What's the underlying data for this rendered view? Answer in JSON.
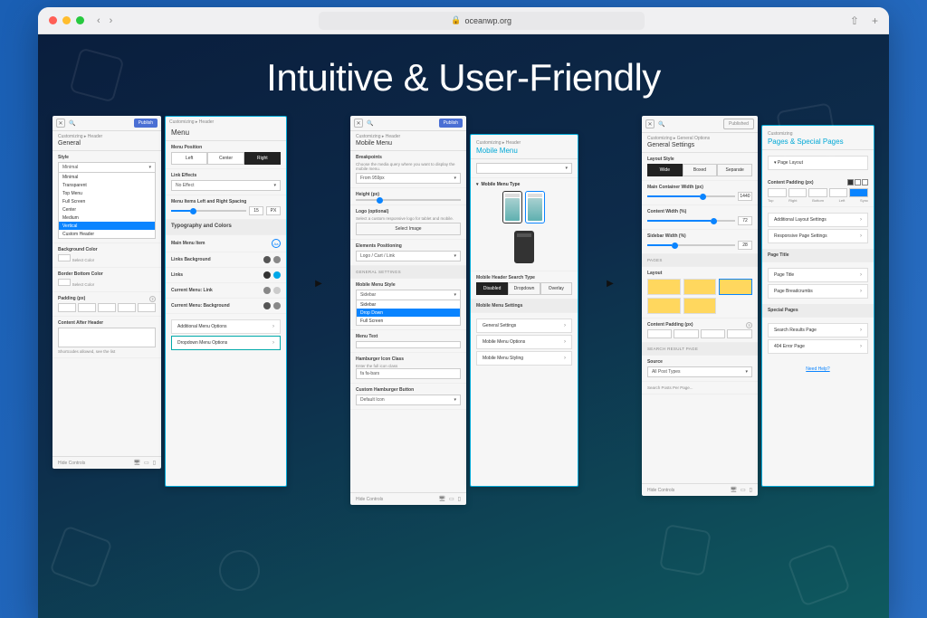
{
  "browser": {
    "url": "oceanwp.org"
  },
  "headline": "Intuitive & User-Friendly",
  "publish": "Publish",
  "published": "Published",
  "panel1a": {
    "breadcrumb": "Customizing ▸ Header",
    "title": "General",
    "style_label": "Style",
    "style_selected": "Minimal",
    "style_opts": [
      "Minimal",
      "Transparent",
      "Top Menu",
      "Full Screen",
      "Center",
      "Medium"
    ],
    "style_highlight": "Vertical",
    "style_last": "Custom Header",
    "bg_label": "Background Color",
    "select_color": "Select Color",
    "border_label": "Border Bottom Color",
    "padding_label": "Padding (px)",
    "content_after": "Content After Header",
    "shortcodes": "Shortcodes allowed, see the list",
    "hide_controls": "Hide Controls"
  },
  "panel1b": {
    "breadcrumb": "Customizing ▸ Header",
    "title": "Menu",
    "menu_position": "Menu Position",
    "pos_left": "Left",
    "pos_center": "Center",
    "pos_right": "Right",
    "link_effects": "Link Effects",
    "no_effect": "No Effect",
    "spacing": "Menu Items Left and Right Spacing",
    "spacing_val": "15",
    "spacing_px": "PX",
    "typography": "Typography and Colors",
    "main_menu_item": "Main Menu Item",
    "links_bg": "Links Background",
    "links": "Links",
    "current_link": "Current Menu: Link",
    "current_bg": "Current Menu: Background",
    "additional": "Additional Menu Options",
    "dropdown": "Dropdown Menu Options"
  },
  "panel2a": {
    "breadcrumb": "Customizing ▸ Header",
    "title": "Mobile Menu",
    "breakpoints": "Breakpoints",
    "breakpoints_desc": "Choose the media query where you want to display the mobile menu.",
    "from": "From 959px",
    "height": "Height (px)",
    "logo": "Logo (optional)",
    "logo_desc": "Select a custom responsive logo for tablet and mobile.",
    "select_image": "Select Image",
    "elements_pos": "Elements Positioning",
    "logo_cart": "Logo / Cart / Link",
    "general_settings": "GENERAL SETTINGS",
    "mobile_style": "Mobile Menu Style",
    "style_sel": "Sidebar",
    "style_opts": [
      "Sidebar",
      "Drop Down",
      "Full Screen"
    ],
    "style_highlight": "Drop Down",
    "menu_text": "Menu Text",
    "hamburger": "Hamburger Icon Class",
    "hamburger_desc": "Enter the full icon class",
    "fa_bars": "fa fa-bars",
    "custom_btn": "Custom Hamburger Button",
    "default": "Default Icon",
    "hide_controls": "Hide Controls"
  },
  "panel2b": {
    "breadcrumb": "Customizing ▸ Header",
    "title": "Mobile Menu",
    "type_label": "Mobile Menu Type",
    "search_label": "Mobile Header Search Type",
    "disabled": "Disabled",
    "dropdown": "Dropdown",
    "overlay": "Overlay",
    "settings": "Mobile Menu Settings",
    "general": "General Settings",
    "options": "Mobile Menu Options",
    "styling": "Mobile Menu Styling"
  },
  "panel3a": {
    "breadcrumb": "Customizing ▸ General Options",
    "title": "General Settings",
    "layout_style": "Layout Style",
    "wide": "Wide",
    "boxed": "Boxed",
    "separate": "Separate",
    "container_width": "Main Container Width (px)",
    "container_val": "1440",
    "content_width": "Content Width (%)",
    "content_val": "72",
    "sidebar_width": "Sidebar Width (%)",
    "sidebar_val": "28",
    "pages": "PAGES",
    "layout": "Layout",
    "content_padding": "Content Padding (px)",
    "search_result": "SEARCH RESULT PAGE",
    "source": "Source",
    "all_post_types": "All Post Types",
    "search_posts": "Search Posts Per Page...",
    "hide_controls": "Hide Controls"
  },
  "panel3b": {
    "breadcrumb": "Customizing",
    "title": "Pages & Special Pages",
    "page_layout": "Page Layout",
    "content_padding": "Content Padding (px)",
    "top": "Top",
    "right": "Right",
    "bottom": "Bottom",
    "left": "Left",
    "sync": "Sync",
    "additional": "Additional Layout Settings",
    "responsive": "Responsive Page Settings",
    "page_title_h": "Page Title",
    "page_title": "Page Title",
    "breadcrumbs": "Page Breadcrumbs",
    "special": "Special Pages",
    "search_results": "Search Results Page",
    "error_page": "404 Error Page",
    "need_help": "Need Help?"
  }
}
